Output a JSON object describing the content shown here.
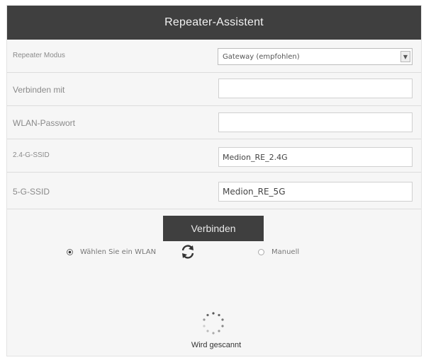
{
  "header": {
    "title": "Repeater-Assistent"
  },
  "form": {
    "mode_label": "Repeater Modus",
    "mode_value": "Gateway (empfohlen)",
    "connect_to_label": "Verbinden mit",
    "connect_to_value": "",
    "wlan_password_label": "WLAN-Passwort",
    "wlan_password_value": "",
    "ssid_24_label": "2.4-G-SSID",
    "ssid_24_value": "Medion_RE_2.4G",
    "ssid_5_label": "5-G-SSID",
    "ssid_5_value": "Medion_RE_5G"
  },
  "actions": {
    "connect_label": "Verbinden"
  },
  "options": {
    "choose_wlan_label": "Wählen Sie ein WLAN",
    "choose_wlan_selected": true,
    "manual_label": "Manuell",
    "manual_selected": false
  },
  "status": {
    "text": "Wird gescannt"
  },
  "colors": {
    "header_bg": "#3f3f3f",
    "button_bg": "#3f3f3f",
    "panel_bg": "#f6f6f6"
  },
  "icons": {
    "refresh": "refresh-icon",
    "spinner": "spinner-icon",
    "dropdown": "chevron-down-icon"
  }
}
